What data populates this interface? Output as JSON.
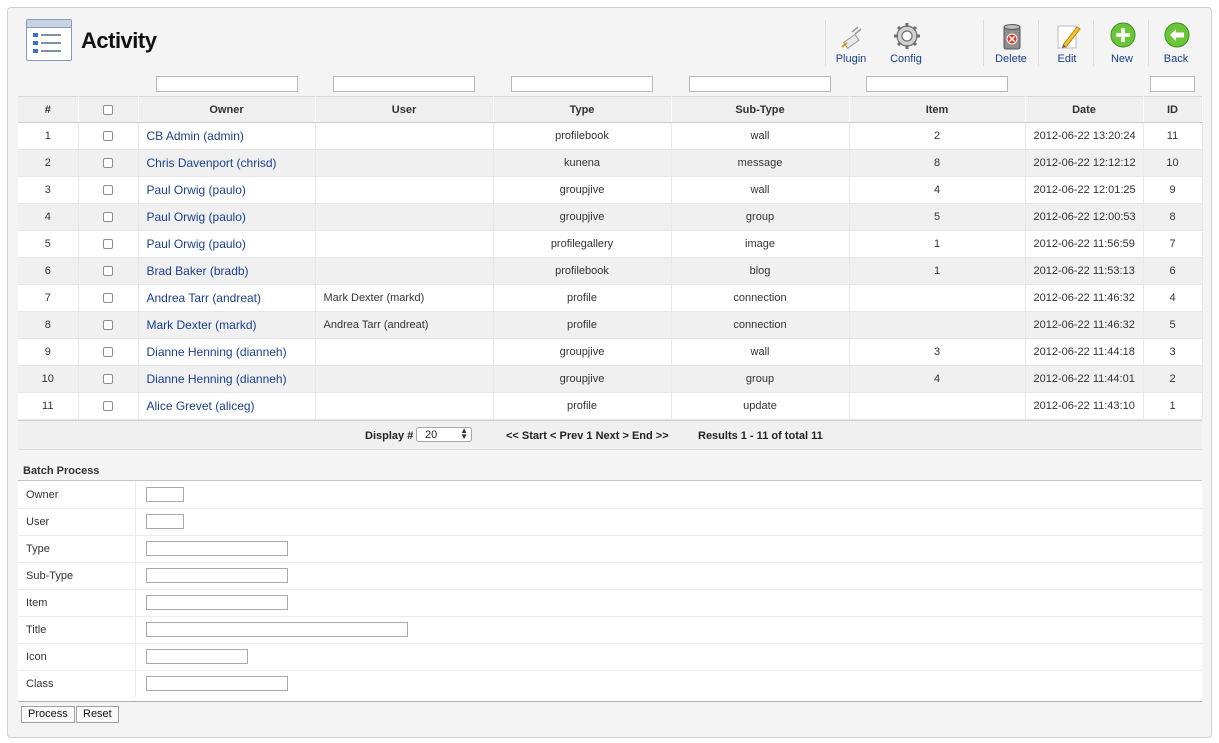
{
  "header": {
    "title": "Activity"
  },
  "toolbar": {
    "plugin": "Plugin",
    "config": "Config",
    "delete": "Delete",
    "edit": "Edit",
    "new": "New",
    "back": "Back"
  },
  "table": {
    "columns": [
      "#",
      "",
      "Owner",
      "User",
      "Type",
      "Sub-Type",
      "Item",
      "Date",
      "ID"
    ],
    "rows": [
      {
        "num": "1",
        "owner": "CB Admin (admin)",
        "user": "",
        "type": "profilebook",
        "subtype": "wall",
        "item": "2",
        "date": "2012-06-22 13:20:24",
        "id": "11"
      },
      {
        "num": "2",
        "owner": "Chris Davenport (chrisd)",
        "user": "",
        "type": "kunena",
        "subtype": "message",
        "item": "8",
        "date": "2012-06-22 12:12:12",
        "id": "10"
      },
      {
        "num": "3",
        "owner": "Paul Orwig (paulo)",
        "user": "",
        "type": "groupjive",
        "subtype": "wall",
        "item": "4",
        "date": "2012-06-22 12:01:25",
        "id": "9"
      },
      {
        "num": "4",
        "owner": "Paul Orwig (paulo)",
        "user": "",
        "type": "groupjive",
        "subtype": "group",
        "item": "5",
        "date": "2012-06-22 12:00:53",
        "id": "8"
      },
      {
        "num": "5",
        "owner": "Paul Orwig (paulo)",
        "user": "",
        "type": "profilegallery",
        "subtype": "image",
        "item": "1",
        "date": "2012-06-22 11:56:59",
        "id": "7"
      },
      {
        "num": "6",
        "owner": "Brad Baker (bradb)",
        "user": "",
        "type": "profilebook",
        "subtype": "blog",
        "item": "1",
        "date": "2012-06-22 11:53:13",
        "id": "6"
      },
      {
        "num": "7",
        "owner": "Andrea Tarr (andreat)",
        "user": "Mark Dexter (markd)",
        "type": "profile",
        "subtype": "connection",
        "item": "",
        "date": "2012-06-22 11:46:32",
        "id": "4"
      },
      {
        "num": "8",
        "owner": "Mark Dexter (markd)",
        "user": "Andrea Tarr (andreat)",
        "type": "profile",
        "subtype": "connection",
        "item": "",
        "date": "2012-06-22 11:46:32",
        "id": "5"
      },
      {
        "num": "9",
        "owner": "Dianne Henning (dianneh)",
        "user": "",
        "type": "groupjive",
        "subtype": "wall",
        "item": "3",
        "date": "2012-06-22 11:44:18",
        "id": "3"
      },
      {
        "num": "10",
        "owner": "Dianne Henning (dianneh)",
        "user": "",
        "type": "groupjive",
        "subtype": "group",
        "item": "4",
        "date": "2012-06-22 11:44:01",
        "id": "2"
      },
      {
        "num": "11",
        "owner": "Alice Grevet (aliceg)",
        "user": "",
        "type": "profile",
        "subtype": "update",
        "item": "",
        "date": "2012-06-22 11:43:10",
        "id": "1"
      }
    ]
  },
  "pager": {
    "display_label": "Display #",
    "display_value": "20",
    "nav": "<< Start < Prev 1 Next > End >>",
    "results": "Results 1 - 11 of total 11"
  },
  "batch": {
    "title": "Batch Process",
    "fields": [
      "Owner",
      "User",
      "Type",
      "Sub-Type",
      "Item",
      "Title",
      "Icon",
      "Class"
    ],
    "process_label": "Process",
    "reset_label": "Reset"
  }
}
